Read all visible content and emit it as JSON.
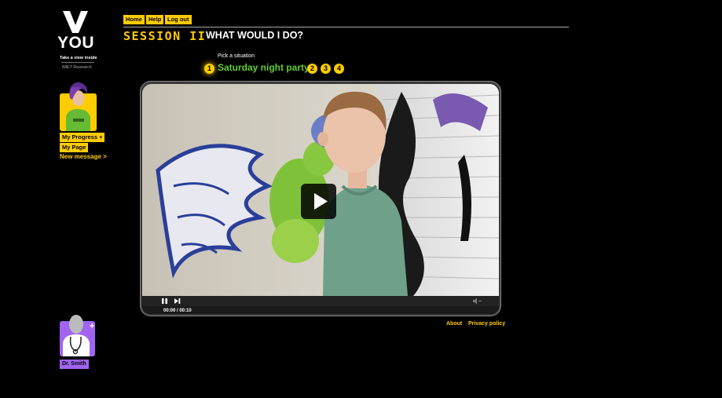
{
  "logo": {
    "letter": "V",
    "brand": "YOU",
    "tagline": "Take a view inside",
    "org": "iMET Research"
  },
  "sidebar": {
    "my_progress": "My Progress +",
    "my_page": "My Page",
    "new_message": "New message >",
    "doctor": "Dr. Smith"
  },
  "nav": {
    "home": "Home",
    "help": "Help",
    "logout": "Log out"
  },
  "header": {
    "session": "SESSION II",
    "title": "WHAT WOULD I DO?"
  },
  "situation": {
    "prompt": "Pick a situation",
    "numbers": [
      "1",
      "2",
      "3",
      "4"
    ],
    "current": "Saturday night party"
  },
  "video": {
    "time": "00:00 / 00:10"
  },
  "footer": {
    "about": "About",
    "privacy": "Privacy policy"
  },
  "colors": {
    "accent": "#ffcc00",
    "situation": "#66cc33",
    "doctor": "#a064f0"
  }
}
